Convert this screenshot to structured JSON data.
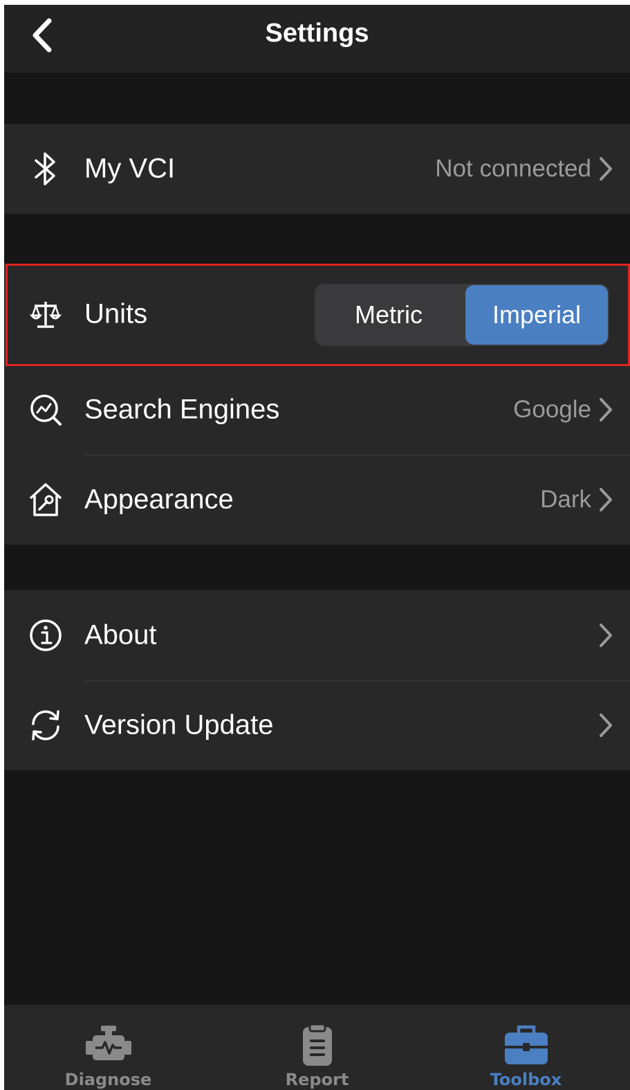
{
  "header": {
    "title": "Settings"
  },
  "groups": {
    "vci": {
      "label": "My VCI",
      "value": "Not connected"
    },
    "units": {
      "label": "Units",
      "options": [
        "Metric",
        "Imperial"
      ],
      "selected": "Imperial"
    },
    "search_engines": {
      "label": "Search Engines",
      "value": "Google"
    },
    "appearance": {
      "label": "Appearance",
      "value": "Dark"
    },
    "about": {
      "label": "About"
    },
    "version_update": {
      "label": "Version Update"
    }
  },
  "tabbar": {
    "items": [
      {
        "label": "Diagnose",
        "icon": "engine-icon",
        "active": false
      },
      {
        "label": "Report",
        "icon": "clipboard-icon",
        "active": false
      },
      {
        "label": "Toolbox",
        "icon": "toolbox-icon",
        "active": true
      }
    ]
  },
  "colors": {
    "accent": "#4a7fc1",
    "highlight_border": "#e02424",
    "background": "#161616",
    "cell": "#282828"
  }
}
